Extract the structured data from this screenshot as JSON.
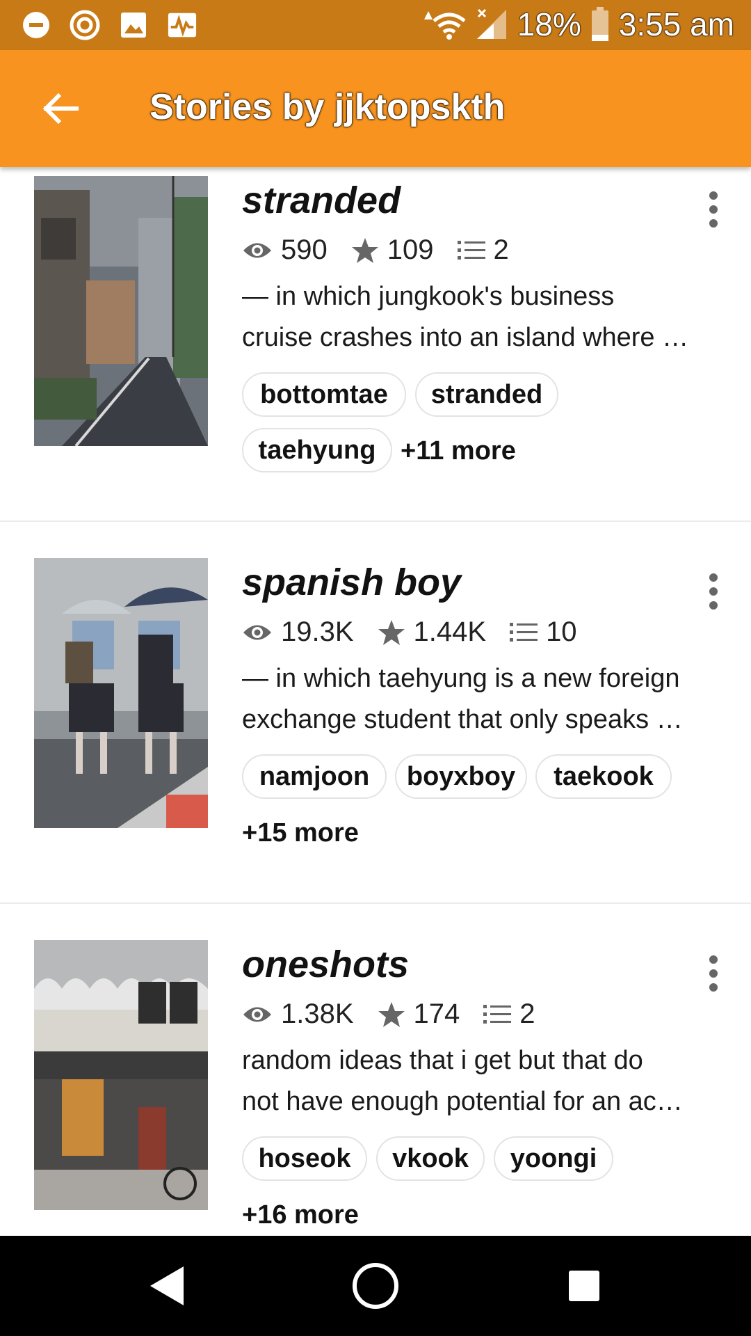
{
  "status_bar": {
    "battery": "18%",
    "time": "3:55 am",
    "icons": [
      "dnd-icon",
      "sync-icon",
      "image-icon",
      "activity-icon",
      "wifi-icon",
      "signal-icon",
      "battery-icon"
    ]
  },
  "app_bar": {
    "title": "Stories by jjktopskth",
    "back_icon": "arrow-left-icon"
  },
  "stories": [
    {
      "title": "stranded",
      "reads": "590",
      "votes": "109",
      "parts": "2",
      "description_lines": [
        "— in which jungkook's business",
        "cruise crashes into an island where …"
      ],
      "tags": [
        "bottomtae",
        "stranded",
        "taehyung"
      ],
      "more": "+11 more"
    },
    {
      "title": "spanish boy",
      "reads": "19.3K",
      "votes": "1.44K",
      "parts": "10",
      "description_lines": [
        "— in which taehyung is a new foreign",
        "exchange student that only speaks …"
      ],
      "tags": [
        "namjoon",
        "boyxboy",
        "taekook"
      ],
      "more": "+15 more"
    },
    {
      "title": "oneshots",
      "reads": "1.38K",
      "votes": "174",
      "parts": "2",
      "description_lines": [
        "random ideas that i get but that do",
        "not have enough potential for an ac…"
      ],
      "tags": [
        "hoseok",
        "vkook",
        "yoongi"
      ],
      "more": "+16 more"
    }
  ],
  "colors": {
    "status_bar": "#c87a16",
    "app_bar": "#f7931e",
    "nav_bar": "#000000"
  },
  "nav_bar": {
    "icons": [
      "back-triangle-icon",
      "home-circle-icon",
      "recents-square-icon"
    ]
  }
}
